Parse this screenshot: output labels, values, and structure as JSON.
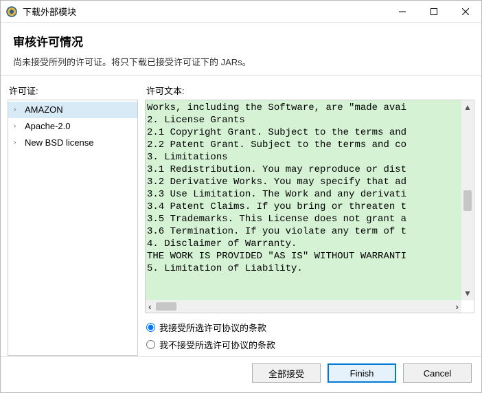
{
  "window": {
    "title": "下载外部模块"
  },
  "header": {
    "heading": "审核许可情况",
    "subtitle": "尚未接受所列的许可证。将只下载已接受许可证下的 JARs。"
  },
  "left": {
    "label": "许可证:",
    "items": [
      {
        "label": "AMAZON",
        "selected": true
      },
      {
        "label": "Apache-2.0",
        "selected": false
      },
      {
        "label": "New BSD license",
        "selected": false
      }
    ]
  },
  "right": {
    "label": "许可文本:",
    "lines": [
      "Works, including the Software, are \"made avai",
      "2. License Grants",
      "2.1 Copyright Grant. Subject to the terms and",
      "2.2 Patent Grant. Subject to the terms and co",
      "3. Limitations",
      "3.1 Redistribution. You may reproduce or dist",
      "3.2 Derivative Works. You may specify that ad",
      "3.3 Use Limitation. The Work and any derivati",
      "3.4 Patent Claims. If you bring or threaten t",
      "3.5 Trademarks. This License does not grant a",
      "3.6 Termination. If you violate any term of t",
      "4. Disclaimer of Warranty.",
      "THE WORK IS PROVIDED \"AS IS\" WITHOUT WARRANTI",
      "5. Limitation of Liability."
    ]
  },
  "radios": {
    "accept": "我接受所选许可协议的条款",
    "reject": "我不接受所选许可协议的条款",
    "selected": "accept"
  },
  "footer": {
    "accept_all": "全部接受",
    "finish": "Finish",
    "cancel": "Cancel"
  }
}
